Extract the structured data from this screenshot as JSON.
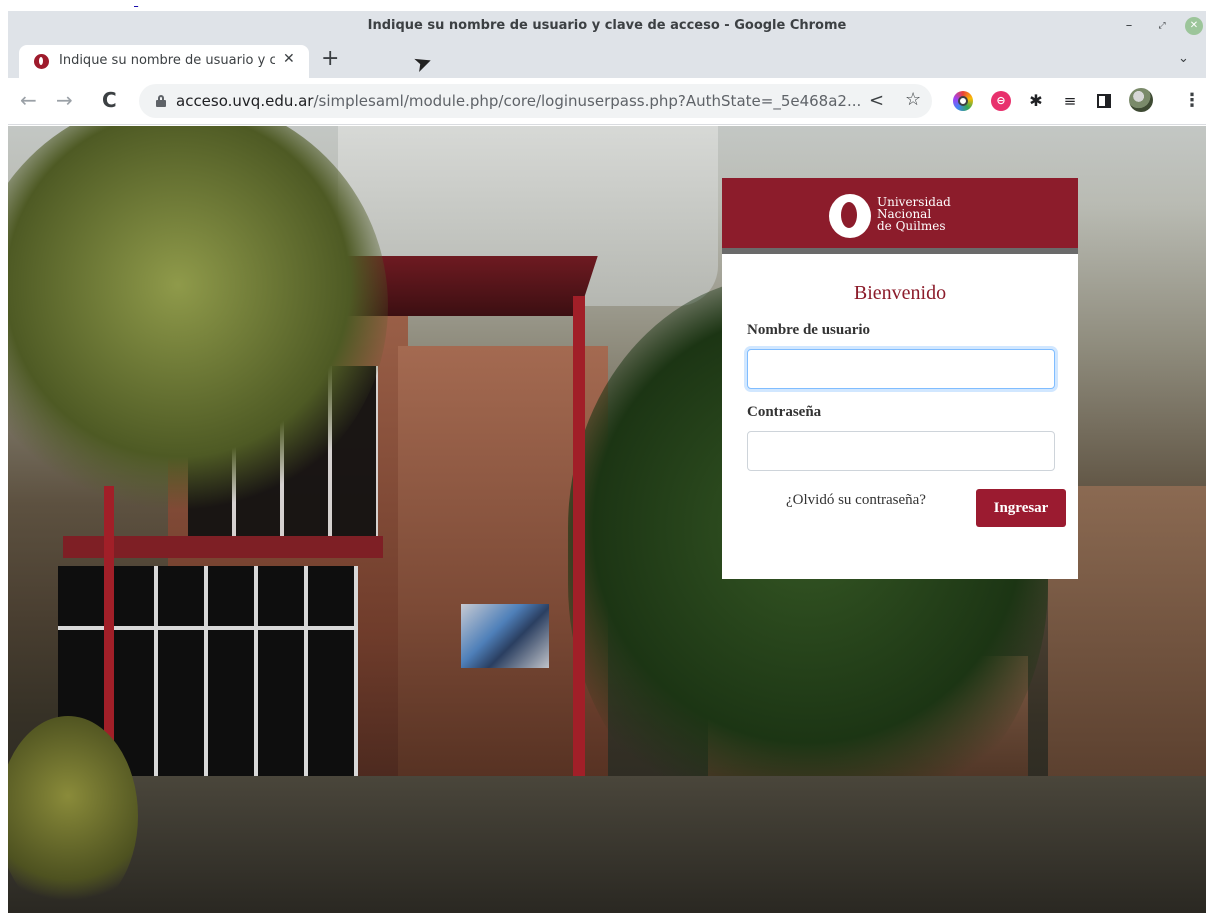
{
  "window": {
    "title": "Indique su nombre de usuario y clave de acceso - Google Chrome",
    "minimize_symbol": "–",
    "maximize_symbol": "⤢",
    "close_symbol": "✕"
  },
  "tab": {
    "title": "Indique su nombre de usuario y clave de acceso",
    "close_symbol": "✕",
    "new_tab_symbol": "+",
    "tab_search_symbol": "⌄"
  },
  "toolbar": {
    "back_symbol": "←",
    "forward_symbol": "→",
    "reload_symbol": "C",
    "url_domain": "acceso.uvq.edu.ar",
    "url_path": "/simplesaml/module.php/core/loginuserpass.php?AuthState=_5e468a2...",
    "share_symbol": "<",
    "bookmark_symbol": "☆",
    "extensions": [
      {
        "icon": "colorful-circle-extension-icon",
        "glyph": ""
      },
      {
        "icon": "pink-extension-icon",
        "glyph": "⊖"
      },
      {
        "icon": "puzzle-extensions-icon",
        "glyph": "✱"
      },
      {
        "icon": "reading-list-icon",
        "glyph": "≡"
      },
      {
        "icon": "side-panel-icon",
        "glyph": ""
      }
    ],
    "menu_symbol": "⋮"
  },
  "login": {
    "university_name": [
      "Universidad",
      "Nacional",
      "de Quilmes"
    ],
    "welcome": "Bienvenido",
    "username_label": "Nombre de usuario",
    "username_value": "",
    "password_label": "Contraseña",
    "password_value": "",
    "forgot_link": "¿Olvidó su contraseña?",
    "submit_label": "Ingresar"
  },
  "colors": {
    "brand": "#8c1c2b",
    "button": "#9b1b30"
  }
}
